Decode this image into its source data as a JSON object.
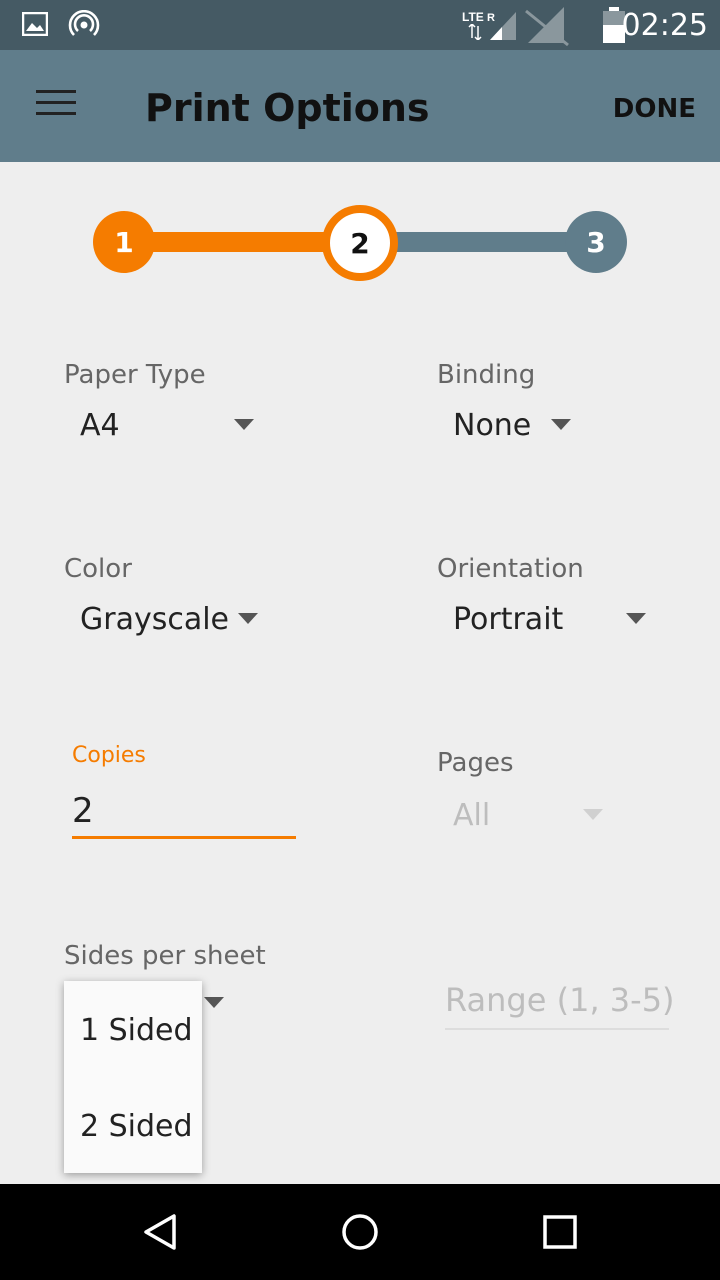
{
  "status_bar": {
    "time": "02:25",
    "network": "LTE",
    "roaming": "R",
    "icons": [
      "image-icon",
      "hotspot-icon",
      "signal-icon",
      "no-sim-icon",
      "battery-icon"
    ]
  },
  "app_bar": {
    "title": "Print Options",
    "done_label": "DONE"
  },
  "stepper": {
    "steps": [
      {
        "label": "1",
        "state": "completed"
      },
      {
        "label": "2",
        "state": "current"
      },
      {
        "label": "3",
        "state": "upcoming"
      }
    ],
    "accent_color": "#f57c00",
    "inactive_color": "#607d8b"
  },
  "form": {
    "paper_type": {
      "label": "Paper Type",
      "value": "A4"
    },
    "binding": {
      "label": "Binding",
      "value": "None"
    },
    "color": {
      "label": "Color",
      "value": "Grayscale"
    },
    "orientation": {
      "label": "Orientation",
      "value": "Portrait"
    },
    "copies": {
      "label": "Copies",
      "value": "2"
    },
    "pages": {
      "label": "Pages",
      "value": "All"
    },
    "sides_per_sheet": {
      "label": "Sides per sheet",
      "options": [
        "1 Sided",
        "2 Sided"
      ]
    },
    "range": {
      "placeholder": "Range (1, 3-5)"
    }
  },
  "nav_bar": {
    "icons": [
      "back-icon",
      "home-icon",
      "recents-icon"
    ]
  }
}
